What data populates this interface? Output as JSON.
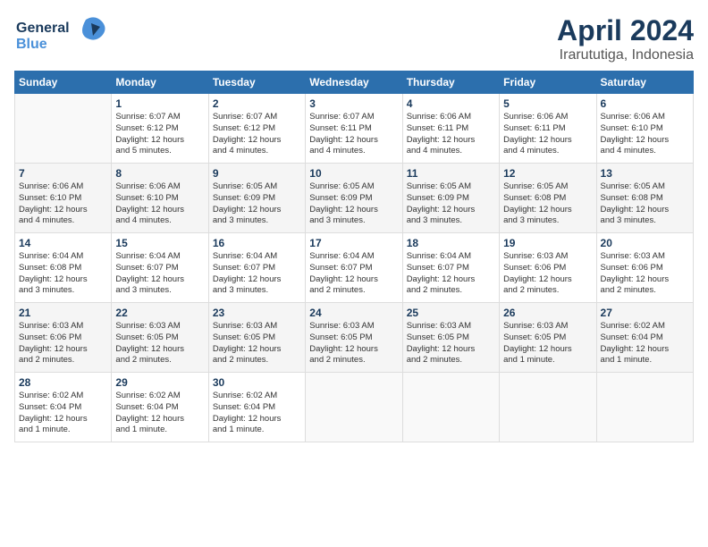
{
  "header": {
    "logo_line1": "General",
    "logo_line2": "Blue",
    "title": "April 2024",
    "subtitle": "Irarututiga, Indonesia"
  },
  "calendar": {
    "weekdays": [
      "Sunday",
      "Monday",
      "Tuesday",
      "Wednesday",
      "Thursday",
      "Friday",
      "Saturday"
    ],
    "weeks": [
      [
        {
          "day": "",
          "info": ""
        },
        {
          "day": "1",
          "info": "Sunrise: 6:07 AM\nSunset: 6:12 PM\nDaylight: 12 hours\nand 5 minutes."
        },
        {
          "day": "2",
          "info": "Sunrise: 6:07 AM\nSunset: 6:12 PM\nDaylight: 12 hours\nand 4 minutes."
        },
        {
          "day": "3",
          "info": "Sunrise: 6:07 AM\nSunset: 6:11 PM\nDaylight: 12 hours\nand 4 minutes."
        },
        {
          "day": "4",
          "info": "Sunrise: 6:06 AM\nSunset: 6:11 PM\nDaylight: 12 hours\nand 4 minutes."
        },
        {
          "day": "5",
          "info": "Sunrise: 6:06 AM\nSunset: 6:11 PM\nDaylight: 12 hours\nand 4 minutes."
        },
        {
          "day": "6",
          "info": "Sunrise: 6:06 AM\nSunset: 6:10 PM\nDaylight: 12 hours\nand 4 minutes."
        }
      ],
      [
        {
          "day": "7",
          "info": "Sunrise: 6:06 AM\nSunset: 6:10 PM\nDaylight: 12 hours\nand 4 minutes."
        },
        {
          "day": "8",
          "info": "Sunrise: 6:06 AM\nSunset: 6:10 PM\nDaylight: 12 hours\nand 4 minutes."
        },
        {
          "day": "9",
          "info": "Sunrise: 6:05 AM\nSunset: 6:09 PM\nDaylight: 12 hours\nand 3 minutes."
        },
        {
          "day": "10",
          "info": "Sunrise: 6:05 AM\nSunset: 6:09 PM\nDaylight: 12 hours\nand 3 minutes."
        },
        {
          "day": "11",
          "info": "Sunrise: 6:05 AM\nSunset: 6:09 PM\nDaylight: 12 hours\nand 3 minutes."
        },
        {
          "day": "12",
          "info": "Sunrise: 6:05 AM\nSunset: 6:08 PM\nDaylight: 12 hours\nand 3 minutes."
        },
        {
          "day": "13",
          "info": "Sunrise: 6:05 AM\nSunset: 6:08 PM\nDaylight: 12 hours\nand 3 minutes."
        }
      ],
      [
        {
          "day": "14",
          "info": "Sunrise: 6:04 AM\nSunset: 6:08 PM\nDaylight: 12 hours\nand 3 minutes."
        },
        {
          "day": "15",
          "info": "Sunrise: 6:04 AM\nSunset: 6:07 PM\nDaylight: 12 hours\nand 3 minutes."
        },
        {
          "day": "16",
          "info": "Sunrise: 6:04 AM\nSunset: 6:07 PM\nDaylight: 12 hours\nand 3 minutes."
        },
        {
          "day": "17",
          "info": "Sunrise: 6:04 AM\nSunset: 6:07 PM\nDaylight: 12 hours\nand 2 minutes."
        },
        {
          "day": "18",
          "info": "Sunrise: 6:04 AM\nSunset: 6:07 PM\nDaylight: 12 hours\nand 2 minutes."
        },
        {
          "day": "19",
          "info": "Sunrise: 6:03 AM\nSunset: 6:06 PM\nDaylight: 12 hours\nand 2 minutes."
        },
        {
          "day": "20",
          "info": "Sunrise: 6:03 AM\nSunset: 6:06 PM\nDaylight: 12 hours\nand 2 minutes."
        }
      ],
      [
        {
          "day": "21",
          "info": "Sunrise: 6:03 AM\nSunset: 6:06 PM\nDaylight: 12 hours\nand 2 minutes."
        },
        {
          "day": "22",
          "info": "Sunrise: 6:03 AM\nSunset: 6:05 PM\nDaylight: 12 hours\nand 2 minutes."
        },
        {
          "day": "23",
          "info": "Sunrise: 6:03 AM\nSunset: 6:05 PM\nDaylight: 12 hours\nand 2 minutes."
        },
        {
          "day": "24",
          "info": "Sunrise: 6:03 AM\nSunset: 6:05 PM\nDaylight: 12 hours\nand 2 minutes."
        },
        {
          "day": "25",
          "info": "Sunrise: 6:03 AM\nSunset: 6:05 PM\nDaylight: 12 hours\nand 2 minutes."
        },
        {
          "day": "26",
          "info": "Sunrise: 6:03 AM\nSunset: 6:05 PM\nDaylight: 12 hours\nand 1 minute."
        },
        {
          "day": "27",
          "info": "Sunrise: 6:02 AM\nSunset: 6:04 PM\nDaylight: 12 hours\nand 1 minute."
        }
      ],
      [
        {
          "day": "28",
          "info": "Sunrise: 6:02 AM\nSunset: 6:04 PM\nDaylight: 12 hours\nand 1 minute."
        },
        {
          "day": "29",
          "info": "Sunrise: 6:02 AM\nSunset: 6:04 PM\nDaylight: 12 hours\nand 1 minute."
        },
        {
          "day": "30",
          "info": "Sunrise: 6:02 AM\nSunset: 6:04 PM\nDaylight: 12 hours\nand 1 minute."
        },
        {
          "day": "",
          "info": ""
        },
        {
          "day": "",
          "info": ""
        },
        {
          "day": "",
          "info": ""
        },
        {
          "day": "",
          "info": ""
        }
      ]
    ]
  }
}
